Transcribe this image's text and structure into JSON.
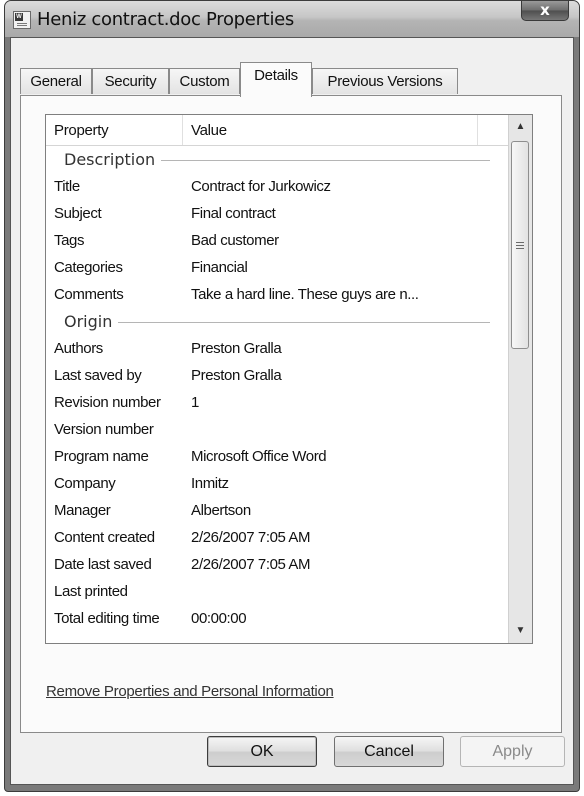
{
  "window": {
    "title": "Heniz contract.doc Properties",
    "close_label": "x"
  },
  "tabs": [
    {
      "label": "General",
      "active": false
    },
    {
      "label": "Security",
      "active": false
    },
    {
      "label": "Custom",
      "active": false
    },
    {
      "label": "Details",
      "active": true
    },
    {
      "label": "Previous Versions",
      "active": false
    }
  ],
  "details": {
    "columns": [
      "Property",
      "Value"
    ],
    "sections": [
      {
        "name": "Description",
        "rows": [
          {
            "property": "Title",
            "value": "Contract for Jurkowicz"
          },
          {
            "property": "Subject",
            "value": "Final contract"
          },
          {
            "property": "Tags",
            "value": "Bad customer"
          },
          {
            "property": "Categories",
            "value": "Financial"
          },
          {
            "property": "Comments",
            "value": "Take a hard line. These guys are n..."
          }
        ]
      },
      {
        "name": "Origin",
        "rows": [
          {
            "property": "Authors",
            "value": "Preston Gralla"
          },
          {
            "property": "Last saved by",
            "value": "Preston Gralla"
          },
          {
            "property": "Revision number",
            "value": "1"
          },
          {
            "property": "Version number",
            "value": ""
          },
          {
            "property": "Program name",
            "value": "Microsoft Office Word"
          },
          {
            "property": "Company",
            "value": "Inmitz"
          },
          {
            "property": "Manager",
            "value": "Albertson"
          },
          {
            "property": "Content created",
            "value": "2/26/2007 7:05 AM"
          },
          {
            "property": "Date last saved",
            "value": "2/26/2007 7:05 AM"
          },
          {
            "property": "Last printed",
            "value": ""
          },
          {
            "property": "Total editing time",
            "value": "00:00:00"
          }
        ]
      }
    ]
  },
  "link": {
    "label": "Remove Properties and Personal Information"
  },
  "buttons": {
    "ok": "OK",
    "cancel": "Cancel",
    "apply": "Apply"
  }
}
